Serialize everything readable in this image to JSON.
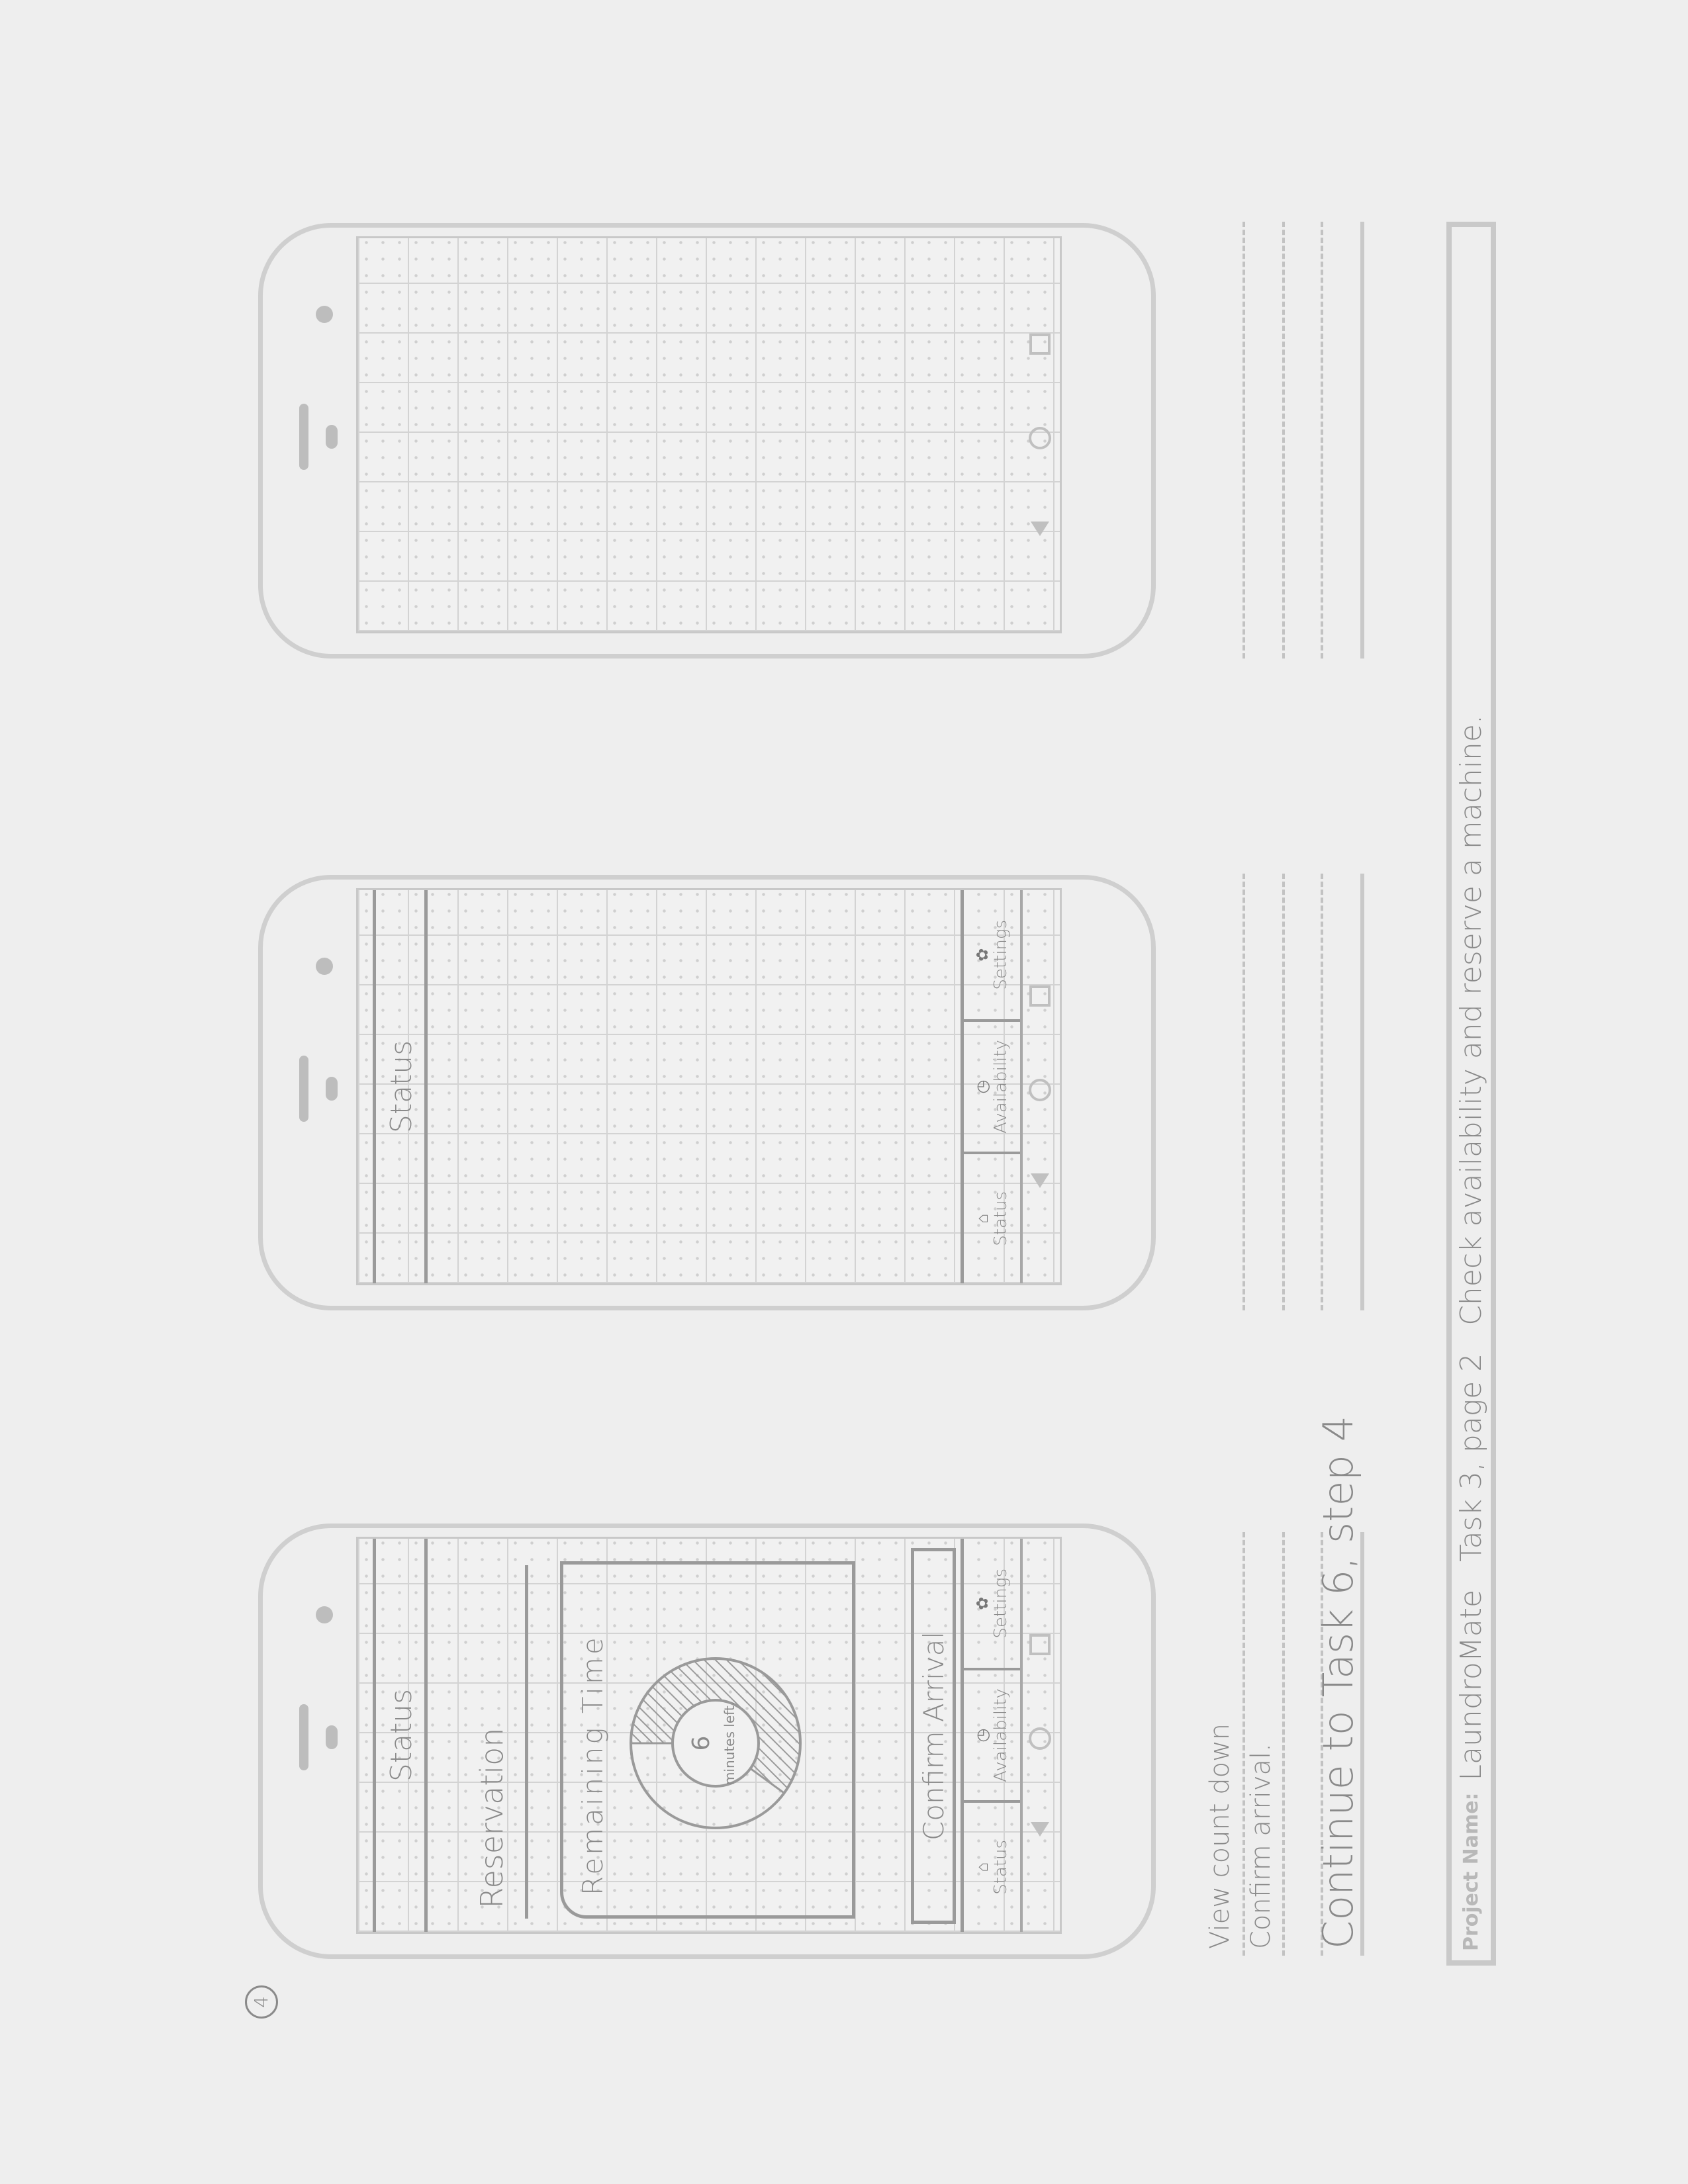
{
  "page_number": "4",
  "phones": [
    {
      "header_title": "Status",
      "reservation_label": "Reservation",
      "card": {
        "title": "Remaining Time",
        "timer_value": "6",
        "timer_unit": "minutes left."
      },
      "timer_remaining_fraction": 0.6,
      "confirm_button": "Confirm Arrival",
      "tabs": [
        {
          "label": "Status",
          "icon": "home-icon"
        },
        {
          "label": "Availability",
          "icon": "clock-icon"
        },
        {
          "label": "Settings",
          "icon": "gear-icon"
        }
      ]
    },
    {
      "header_title": "Status",
      "tabs": [
        {
          "label": "Status",
          "icon": "home-icon"
        },
        {
          "label": "Availability",
          "icon": "clock-icon"
        },
        {
          "label": "Settings",
          "icon": "gear-icon"
        }
      ]
    },
    {}
  ],
  "notes": {
    "line1": "View count down",
    "line2": "Confirm arrival.",
    "line3": "Continue to Task 6, step 4"
  },
  "footer": {
    "label": "Project Name:",
    "value": "LaundroMate   Task 3, page 2   Check availability and reserve a machine."
  },
  "colors": {
    "pencil": "#8a8a8a",
    "paper": "#eeeeee",
    "template": "#cfcfcf"
  }
}
